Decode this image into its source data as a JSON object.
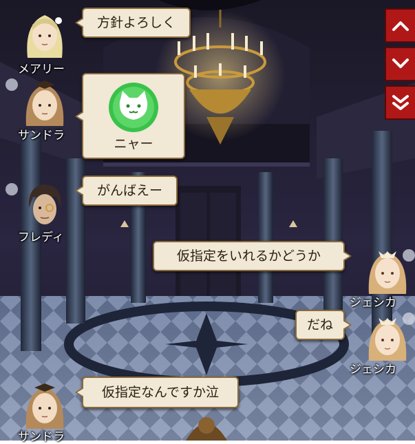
{
  "messages": [
    {
      "speaker": "メアリー",
      "text": "方針よろしく"
    },
    {
      "speaker": "サンドラ",
      "stamp": "cat-face-icon",
      "text": "ニャー"
    },
    {
      "speaker": "フレディ",
      "text": "がんばえー"
    },
    {
      "speaker": "ジェシカ",
      "text": "仮指定をいれるかどうか"
    },
    {
      "speaker": "ジェシカ",
      "text": "だね"
    },
    {
      "speaker": "サンドラ",
      "text": "仮指定なんですか泣"
    }
  ],
  "nav": {
    "scroll_up_icon": "chevron-up-icon",
    "scroll_down_icon": "chevron-down-icon",
    "jump_latest_icon": "double-chevron-down-icon"
  },
  "colors": {
    "bubble_fill": "#f1e8d6",
    "bubble_border": "#8a6a3a",
    "nav_button": "#b01818",
    "stamp_green": "#39c24a"
  }
}
